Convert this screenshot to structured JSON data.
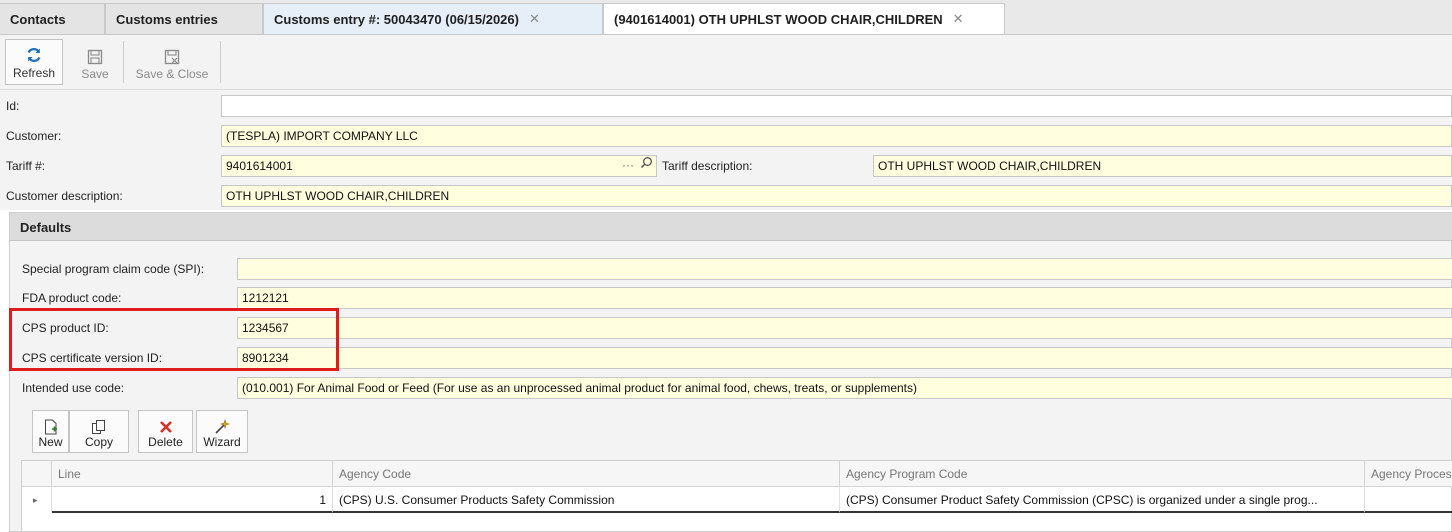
{
  "tabs": [
    {
      "label": "Contacts"
    },
    {
      "label": "Customs entries"
    },
    {
      "label": "Customs entry #: 50043470 (06/15/2026)"
    },
    {
      "label": "(9401614001) OTH UPHLST WOOD CHAIR,CHILDREN"
    }
  ],
  "toolbar": {
    "refresh_label": "Refresh",
    "save_label": "Save",
    "save_close_label": "Save & Close"
  },
  "form": {
    "id_label": "Id:",
    "id_value": "",
    "customer_label": "Customer:",
    "customer_value": "(TESPLA) IMPORT COMPANY LLC",
    "tariff_label": "Tariff #:",
    "tariff_value": "9401614001",
    "tariff_desc_label": "Tariff description:",
    "tariff_desc_value": "OTH UPHLST WOOD CHAIR,CHILDREN",
    "customer_desc_label": "Customer description:",
    "customer_desc_value": "OTH UPHLST WOOD CHAIR,CHILDREN"
  },
  "defaults": {
    "title": "Defaults",
    "spi_label": "Special program claim code (SPI):",
    "spi_value": "",
    "fda_label": "FDA product code:",
    "fda_value": "1212121",
    "cps_product_label": "CPS product ID:",
    "cps_product_value": "1234567",
    "cps_cert_label": "CPS certificate version ID:",
    "cps_cert_value": "8901234",
    "intended_label": "Intended use code:",
    "intended_value": "(010.001) For Animal Food or Feed (For use as an unprocessed animal product for animal food, chews, treats, or supplements)"
  },
  "grid_toolbar": {
    "new_label": "New",
    "copy_label": "Copy",
    "delete_label": "Delete",
    "wizard_label": "Wizard"
  },
  "grid": {
    "headers": [
      "Line",
      "Agency Code",
      "Agency Program Code",
      "Agency Proces"
    ],
    "rows": [
      {
        "line": "1",
        "agency_code": "(CPS) U.S. Consumer Products Safety Commission",
        "program_code": "(CPS) Consumer Product Safety Commission (CPSC) is organized under a single prog..."
      }
    ]
  },
  "colors": {
    "highlight": "#e01b1b",
    "required_field": "#ffffe0",
    "active_tab_bg": "#ffffff",
    "refresh_icon": "#1e6fb8",
    "delete_icon": "#d9302c"
  },
  "icons": [
    "refresh-icon",
    "save-icon",
    "save-close-icon",
    "ellipsis-icon",
    "search-icon",
    "new-icon",
    "copy-icon",
    "delete-icon",
    "wizard-icon",
    "row-indicator-icon",
    "close-icon"
  ]
}
